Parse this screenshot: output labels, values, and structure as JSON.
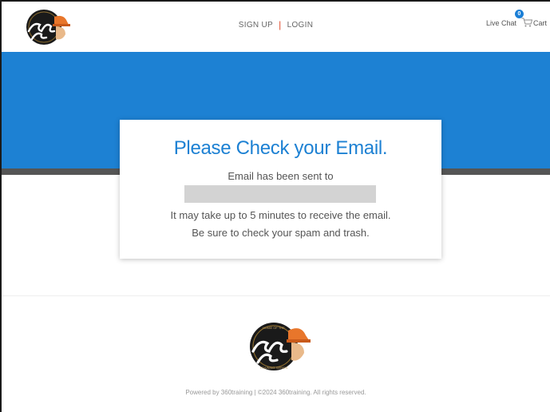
{
  "header": {
    "logo_top_text": "HOME OF THE",
    "logo_word_1": "Hard",
    "logo_word_2": "Hat",
    "logo_bottom_text": "TRAINING SERIES",
    "signup_label": "SIGN UP",
    "separator": "|",
    "login_label": "LOGIN",
    "live_chat_label": "Live Chat",
    "cart_count": "0",
    "cart_label": "Cart"
  },
  "card": {
    "title": "Please Check your Email.",
    "sent_to": "Email has been sent to",
    "line1": "It may take up to 5 minutes to receive the email.",
    "line2": "Be sure to check your spam and trash."
  },
  "footer": {
    "copyright": "Powered by 360training | ©2024 360training. All rights reserved."
  },
  "colors": {
    "brand_blue": "#1d81d3",
    "strip_gray": "#555555",
    "separator_orange": "#e04a2a",
    "badge_blue": "#1b7fd6"
  }
}
